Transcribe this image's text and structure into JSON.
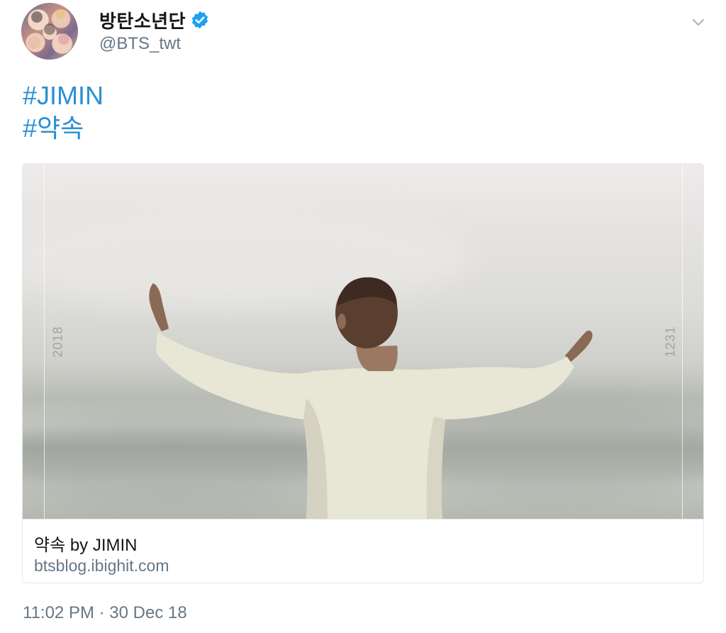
{
  "account": {
    "display_name": "방탄소년단",
    "handle": "@BTS_twt",
    "verified": true,
    "avatar_icon": "group-photo-avatar"
  },
  "menu_icon": "chevron-down-icon",
  "tweet": {
    "hashtags": [
      "#JIMIN",
      "#약속"
    ]
  },
  "card": {
    "image_overlay": {
      "left_text": "2018",
      "right_text": "1231"
    },
    "title": "약속 by JIMIN",
    "domain": "btsblog.ibighit.com"
  },
  "timestamp": "11:02 PM · 30 Dec 18",
  "colors": {
    "link": "#2a8fd4",
    "verified": "#1da1f2",
    "secondary_text": "#657786",
    "border": "#e1e8ed"
  }
}
